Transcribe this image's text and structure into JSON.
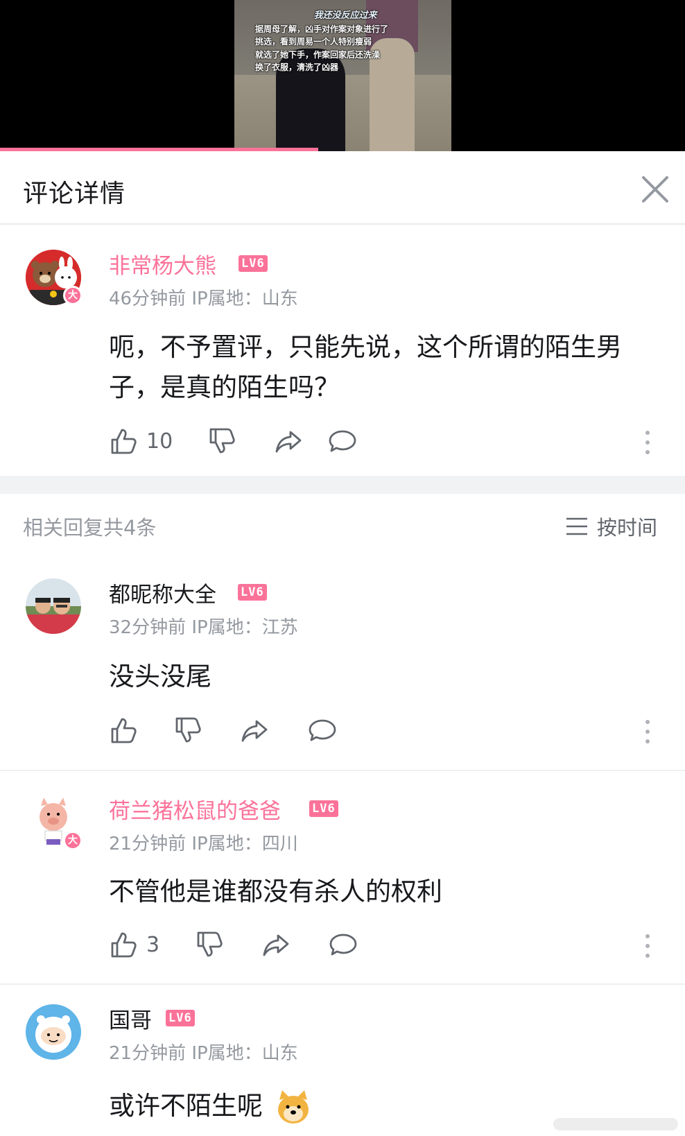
{
  "video": {
    "caption_title": "我还没反应过来",
    "caption_lines": [
      "据周母了解，凶手对作案对象进行了",
      "挑选，看到周易一个人特别瘦弱",
      "就选了她下手，作案回家后还洗澡",
      "换了衣服，清洗了凶器"
    ],
    "progress_fraction": 0.465,
    "accent_color": "#fb7299"
  },
  "header": {
    "title": "评论详情",
    "close_icon": "close-icon"
  },
  "main_comment": {
    "username": "非常杨大熊",
    "level": "LV6",
    "vip": true,
    "meta": "46分钟前 IP属地：山东",
    "body": "呃，不予置评，只能先说，这个所谓的陌生男子，是真的陌生吗？",
    "likes": "10"
  },
  "replies_section": {
    "count_label": "相关回复共4条",
    "sort_label": "按时间"
  },
  "replies": [
    {
      "username": "都昵称大全",
      "level": "LV6",
      "vip": false,
      "meta": "32分钟前 IP属地：江苏",
      "body": "没头没尾",
      "likes": ""
    },
    {
      "username": "荷兰猪松鼠的爸爸",
      "level": "LV6",
      "vip": true,
      "meta": "21分钟前 IP属地：四川",
      "body": "不管他是谁都没有杀人的权利",
      "likes": "3"
    },
    {
      "username": "国哥",
      "level": "LV6",
      "vip": false,
      "meta": "21分钟前 IP属地：山东",
      "body": "或许不陌生呢",
      "likes": ""
    }
  ],
  "badge_text": "大"
}
